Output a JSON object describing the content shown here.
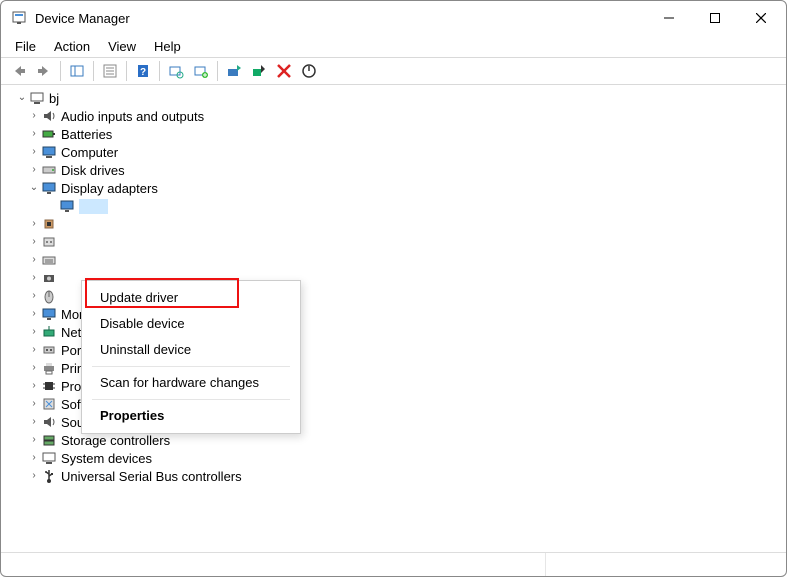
{
  "window": {
    "title": "Device Manager"
  },
  "menubar": [
    "File",
    "Action",
    "View",
    "Help"
  ],
  "tree": {
    "root": "bj",
    "nodes": [
      {
        "label": "Audio inputs and outputs",
        "icon": "speaker"
      },
      {
        "label": "Batteries",
        "icon": "battery"
      },
      {
        "label": "Computer",
        "icon": "computer"
      },
      {
        "label": "Disk drives",
        "icon": "disk"
      },
      {
        "label": "Display adapters",
        "icon": "display",
        "expanded": true,
        "selectedChild": true
      },
      {
        "label": "",
        "icon": "chip",
        "hidden": true
      },
      {
        "label": "",
        "icon": "printer",
        "hidden": true
      },
      {
        "label": "",
        "icon": "keyboard",
        "hidden": true
      },
      {
        "label": "",
        "icon": "camera",
        "hidden": true
      },
      {
        "label": "",
        "icon": "mouse",
        "hidden": true
      },
      {
        "label": "Monitors",
        "icon": "monitor",
        "partial": true
      },
      {
        "label": "Network adapters",
        "icon": "network"
      },
      {
        "label": "Ports (COM & LPT)",
        "icon": "port"
      },
      {
        "label": "Print queues",
        "icon": "printer"
      },
      {
        "label": "Processors",
        "icon": "cpu"
      },
      {
        "label": "Software devices",
        "icon": "software"
      },
      {
        "label": "Sound, video and game controllers",
        "icon": "speaker"
      },
      {
        "label": "Storage controllers",
        "icon": "storage"
      },
      {
        "label": "System devices",
        "icon": "system"
      },
      {
        "label": "Universal Serial Bus controllers",
        "icon": "usb"
      }
    ]
  },
  "context_menu": {
    "items": [
      {
        "label": "Update driver"
      },
      {
        "label": "Disable device"
      },
      {
        "label": "Uninstall device"
      },
      {
        "sep": true
      },
      {
        "label": "Scan for hardware changes"
      },
      {
        "sep": true
      },
      {
        "label": "Properties",
        "bold": true
      }
    ],
    "highlighted_index": 0
  }
}
